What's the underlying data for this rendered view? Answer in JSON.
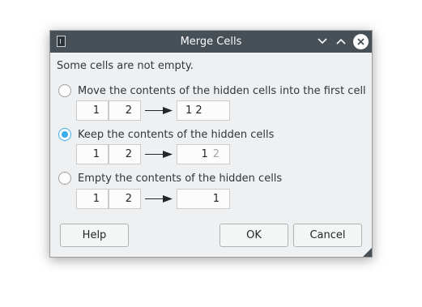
{
  "window": {
    "title": "Merge Cells",
    "icon": "app-icon"
  },
  "prompt": "Some cells are not empty.",
  "options": [
    {
      "label": "Move the contents of the hidden cells into the first cell",
      "checked": false,
      "cell1": "1",
      "cell2": "2",
      "result": "1 2"
    },
    {
      "label": "Keep the contents of the hidden cells",
      "checked": true,
      "cell1": "1",
      "cell2": "2",
      "result": "1",
      "result_hidden": "2"
    },
    {
      "label": "Empty the contents of the hidden cells",
      "checked": false,
      "cell1": "1",
      "cell2": "2",
      "result": "1"
    }
  ],
  "buttons": {
    "help": "Help",
    "ok": "OK",
    "cancel": "Cancel"
  },
  "colors": {
    "titlebar": "#475057",
    "accent": "#3daee9",
    "dialog_bg": "#eff0f1"
  }
}
